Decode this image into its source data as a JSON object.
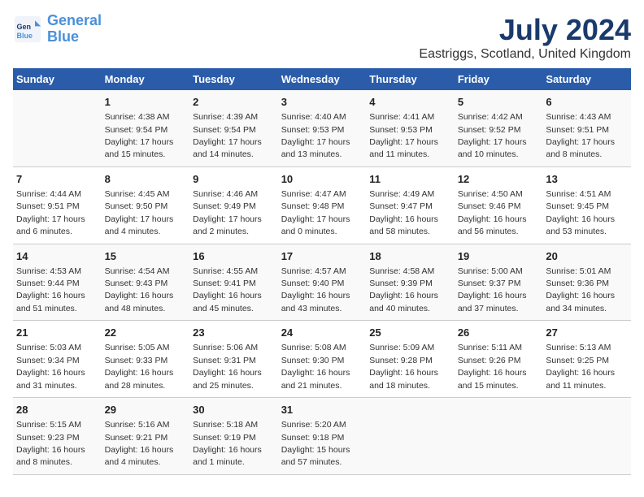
{
  "header": {
    "logo_line1": "General",
    "logo_line2": "Blue",
    "title": "July 2024",
    "subtitle": "Eastriggs, Scotland, United Kingdom"
  },
  "columns": [
    "Sunday",
    "Monday",
    "Tuesday",
    "Wednesday",
    "Thursday",
    "Friday",
    "Saturday"
  ],
  "weeks": [
    [
      {
        "day": "",
        "info": ""
      },
      {
        "day": "1",
        "info": "Sunrise: 4:38 AM\nSunset: 9:54 PM\nDaylight: 17 hours\nand 15 minutes."
      },
      {
        "day": "2",
        "info": "Sunrise: 4:39 AM\nSunset: 9:54 PM\nDaylight: 17 hours\nand 14 minutes."
      },
      {
        "day": "3",
        "info": "Sunrise: 4:40 AM\nSunset: 9:53 PM\nDaylight: 17 hours\nand 13 minutes."
      },
      {
        "day": "4",
        "info": "Sunrise: 4:41 AM\nSunset: 9:53 PM\nDaylight: 17 hours\nand 11 minutes."
      },
      {
        "day": "5",
        "info": "Sunrise: 4:42 AM\nSunset: 9:52 PM\nDaylight: 17 hours\nand 10 minutes."
      },
      {
        "day": "6",
        "info": "Sunrise: 4:43 AM\nSunset: 9:51 PM\nDaylight: 17 hours\nand 8 minutes."
      }
    ],
    [
      {
        "day": "7",
        "info": "Sunrise: 4:44 AM\nSunset: 9:51 PM\nDaylight: 17 hours\nand 6 minutes."
      },
      {
        "day": "8",
        "info": "Sunrise: 4:45 AM\nSunset: 9:50 PM\nDaylight: 17 hours\nand 4 minutes."
      },
      {
        "day": "9",
        "info": "Sunrise: 4:46 AM\nSunset: 9:49 PM\nDaylight: 17 hours\nand 2 minutes."
      },
      {
        "day": "10",
        "info": "Sunrise: 4:47 AM\nSunset: 9:48 PM\nDaylight: 17 hours\nand 0 minutes."
      },
      {
        "day": "11",
        "info": "Sunrise: 4:49 AM\nSunset: 9:47 PM\nDaylight: 16 hours\nand 58 minutes."
      },
      {
        "day": "12",
        "info": "Sunrise: 4:50 AM\nSunset: 9:46 PM\nDaylight: 16 hours\nand 56 minutes."
      },
      {
        "day": "13",
        "info": "Sunrise: 4:51 AM\nSunset: 9:45 PM\nDaylight: 16 hours\nand 53 minutes."
      }
    ],
    [
      {
        "day": "14",
        "info": "Sunrise: 4:53 AM\nSunset: 9:44 PM\nDaylight: 16 hours\nand 51 minutes."
      },
      {
        "day": "15",
        "info": "Sunrise: 4:54 AM\nSunset: 9:43 PM\nDaylight: 16 hours\nand 48 minutes."
      },
      {
        "day": "16",
        "info": "Sunrise: 4:55 AM\nSunset: 9:41 PM\nDaylight: 16 hours\nand 45 minutes."
      },
      {
        "day": "17",
        "info": "Sunrise: 4:57 AM\nSunset: 9:40 PM\nDaylight: 16 hours\nand 43 minutes."
      },
      {
        "day": "18",
        "info": "Sunrise: 4:58 AM\nSunset: 9:39 PM\nDaylight: 16 hours\nand 40 minutes."
      },
      {
        "day": "19",
        "info": "Sunrise: 5:00 AM\nSunset: 9:37 PM\nDaylight: 16 hours\nand 37 minutes."
      },
      {
        "day": "20",
        "info": "Sunrise: 5:01 AM\nSunset: 9:36 PM\nDaylight: 16 hours\nand 34 minutes."
      }
    ],
    [
      {
        "day": "21",
        "info": "Sunrise: 5:03 AM\nSunset: 9:34 PM\nDaylight: 16 hours\nand 31 minutes."
      },
      {
        "day": "22",
        "info": "Sunrise: 5:05 AM\nSunset: 9:33 PM\nDaylight: 16 hours\nand 28 minutes."
      },
      {
        "day": "23",
        "info": "Sunrise: 5:06 AM\nSunset: 9:31 PM\nDaylight: 16 hours\nand 25 minutes."
      },
      {
        "day": "24",
        "info": "Sunrise: 5:08 AM\nSunset: 9:30 PM\nDaylight: 16 hours\nand 21 minutes."
      },
      {
        "day": "25",
        "info": "Sunrise: 5:09 AM\nSunset: 9:28 PM\nDaylight: 16 hours\nand 18 minutes."
      },
      {
        "day": "26",
        "info": "Sunrise: 5:11 AM\nSunset: 9:26 PM\nDaylight: 16 hours\nand 15 minutes."
      },
      {
        "day": "27",
        "info": "Sunrise: 5:13 AM\nSunset: 9:25 PM\nDaylight: 16 hours\nand 11 minutes."
      }
    ],
    [
      {
        "day": "28",
        "info": "Sunrise: 5:15 AM\nSunset: 9:23 PM\nDaylight: 16 hours\nand 8 minutes."
      },
      {
        "day": "29",
        "info": "Sunrise: 5:16 AM\nSunset: 9:21 PM\nDaylight: 16 hours\nand 4 minutes."
      },
      {
        "day": "30",
        "info": "Sunrise: 5:18 AM\nSunset: 9:19 PM\nDaylight: 16 hours\nand 1 minute."
      },
      {
        "day": "31",
        "info": "Sunrise: 5:20 AM\nSunset: 9:18 PM\nDaylight: 15 hours\nand 57 minutes."
      },
      {
        "day": "",
        "info": ""
      },
      {
        "day": "",
        "info": ""
      },
      {
        "day": "",
        "info": ""
      }
    ]
  ]
}
